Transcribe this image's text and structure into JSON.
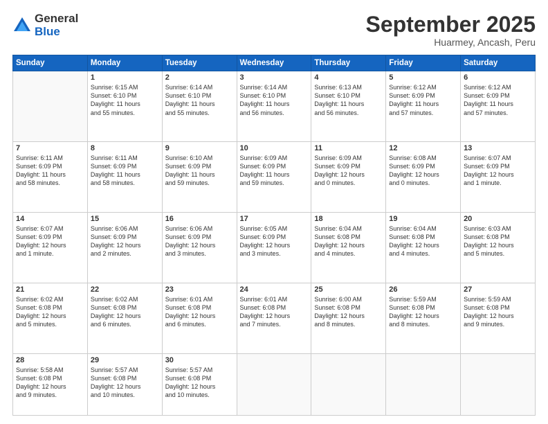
{
  "logo": {
    "general": "General",
    "blue": "Blue"
  },
  "title": "September 2025",
  "location": "Huarmey, Ancash, Peru",
  "days_of_week": [
    "Sunday",
    "Monday",
    "Tuesday",
    "Wednesday",
    "Thursday",
    "Friday",
    "Saturday"
  ],
  "weeks": [
    [
      {
        "day": "",
        "info": ""
      },
      {
        "day": "1",
        "info": "Sunrise: 6:15 AM\nSunset: 6:10 PM\nDaylight: 11 hours\nand 55 minutes."
      },
      {
        "day": "2",
        "info": "Sunrise: 6:14 AM\nSunset: 6:10 PM\nDaylight: 11 hours\nand 55 minutes."
      },
      {
        "day": "3",
        "info": "Sunrise: 6:14 AM\nSunset: 6:10 PM\nDaylight: 11 hours\nand 56 minutes."
      },
      {
        "day": "4",
        "info": "Sunrise: 6:13 AM\nSunset: 6:10 PM\nDaylight: 11 hours\nand 56 minutes."
      },
      {
        "day": "5",
        "info": "Sunrise: 6:12 AM\nSunset: 6:09 PM\nDaylight: 11 hours\nand 57 minutes."
      },
      {
        "day": "6",
        "info": "Sunrise: 6:12 AM\nSunset: 6:09 PM\nDaylight: 11 hours\nand 57 minutes."
      }
    ],
    [
      {
        "day": "7",
        "info": "Sunrise: 6:11 AM\nSunset: 6:09 PM\nDaylight: 11 hours\nand 58 minutes."
      },
      {
        "day": "8",
        "info": "Sunrise: 6:11 AM\nSunset: 6:09 PM\nDaylight: 11 hours\nand 58 minutes."
      },
      {
        "day": "9",
        "info": "Sunrise: 6:10 AM\nSunset: 6:09 PM\nDaylight: 11 hours\nand 59 minutes."
      },
      {
        "day": "10",
        "info": "Sunrise: 6:09 AM\nSunset: 6:09 PM\nDaylight: 11 hours\nand 59 minutes."
      },
      {
        "day": "11",
        "info": "Sunrise: 6:09 AM\nSunset: 6:09 PM\nDaylight: 12 hours\nand 0 minutes."
      },
      {
        "day": "12",
        "info": "Sunrise: 6:08 AM\nSunset: 6:09 PM\nDaylight: 12 hours\nand 0 minutes."
      },
      {
        "day": "13",
        "info": "Sunrise: 6:07 AM\nSunset: 6:09 PM\nDaylight: 12 hours\nand 1 minute."
      }
    ],
    [
      {
        "day": "14",
        "info": "Sunrise: 6:07 AM\nSunset: 6:09 PM\nDaylight: 12 hours\nand 1 minute."
      },
      {
        "day": "15",
        "info": "Sunrise: 6:06 AM\nSunset: 6:09 PM\nDaylight: 12 hours\nand 2 minutes."
      },
      {
        "day": "16",
        "info": "Sunrise: 6:06 AM\nSunset: 6:09 PM\nDaylight: 12 hours\nand 3 minutes."
      },
      {
        "day": "17",
        "info": "Sunrise: 6:05 AM\nSunset: 6:09 PM\nDaylight: 12 hours\nand 3 minutes."
      },
      {
        "day": "18",
        "info": "Sunrise: 6:04 AM\nSunset: 6:08 PM\nDaylight: 12 hours\nand 4 minutes."
      },
      {
        "day": "19",
        "info": "Sunrise: 6:04 AM\nSunset: 6:08 PM\nDaylight: 12 hours\nand 4 minutes."
      },
      {
        "day": "20",
        "info": "Sunrise: 6:03 AM\nSunset: 6:08 PM\nDaylight: 12 hours\nand 5 minutes."
      }
    ],
    [
      {
        "day": "21",
        "info": "Sunrise: 6:02 AM\nSunset: 6:08 PM\nDaylight: 12 hours\nand 5 minutes."
      },
      {
        "day": "22",
        "info": "Sunrise: 6:02 AM\nSunset: 6:08 PM\nDaylight: 12 hours\nand 6 minutes."
      },
      {
        "day": "23",
        "info": "Sunrise: 6:01 AM\nSunset: 6:08 PM\nDaylight: 12 hours\nand 6 minutes."
      },
      {
        "day": "24",
        "info": "Sunrise: 6:01 AM\nSunset: 6:08 PM\nDaylight: 12 hours\nand 7 minutes."
      },
      {
        "day": "25",
        "info": "Sunrise: 6:00 AM\nSunset: 6:08 PM\nDaylight: 12 hours\nand 8 minutes."
      },
      {
        "day": "26",
        "info": "Sunrise: 5:59 AM\nSunset: 6:08 PM\nDaylight: 12 hours\nand 8 minutes."
      },
      {
        "day": "27",
        "info": "Sunrise: 5:59 AM\nSunset: 6:08 PM\nDaylight: 12 hours\nand 9 minutes."
      }
    ],
    [
      {
        "day": "28",
        "info": "Sunrise: 5:58 AM\nSunset: 6:08 PM\nDaylight: 12 hours\nand 9 minutes."
      },
      {
        "day": "29",
        "info": "Sunrise: 5:57 AM\nSunset: 6:08 PM\nDaylight: 12 hours\nand 10 minutes."
      },
      {
        "day": "30",
        "info": "Sunrise: 5:57 AM\nSunset: 6:08 PM\nDaylight: 12 hours\nand 10 minutes."
      },
      {
        "day": "",
        "info": ""
      },
      {
        "day": "",
        "info": ""
      },
      {
        "day": "",
        "info": ""
      },
      {
        "day": "",
        "info": ""
      }
    ]
  ]
}
